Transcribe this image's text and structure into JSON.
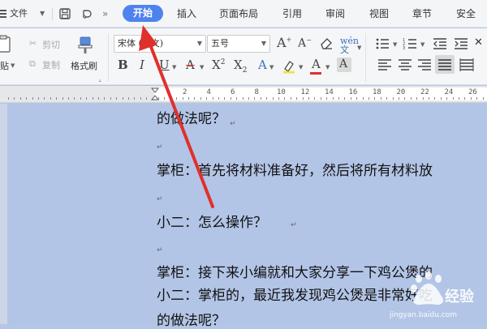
{
  "menu": {
    "file": "文件",
    "more": "»",
    "tabs": [
      "开始",
      "插入",
      "页面布局",
      "引用",
      "审阅",
      "视图",
      "章节",
      "安全"
    ]
  },
  "ribbon": {
    "paste_label": "贴",
    "cut": "剪切",
    "copy": "复制",
    "format_painter": "格式刷",
    "font_name": "宋体 (正文)",
    "font_size": "五号"
  },
  "ruler": {
    "numbers": [
      "2",
      "4",
      "6",
      "8",
      "10",
      "12",
      "14",
      "16",
      "18",
      "20",
      "22",
      "24",
      "26"
    ]
  },
  "document": {
    "lines": [
      "的做法呢？",
      "",
      "掌柜：首先将材料准备好，然后将所有材料放",
      "",
      "小二：怎么操作？",
      "",
      "掌柜：接下来小编就和大家分享一下鸡公煲的",
      "小二：掌柜的，最近我发现鸡公煲是非常好吃",
      "的做法呢？"
    ]
  },
  "watermark": {
    "text": "jingyan.baidu.com"
  },
  "colors": {
    "accent": "#4e83ee",
    "selection": "#b3c5e6",
    "arrow": "#e0302c"
  }
}
